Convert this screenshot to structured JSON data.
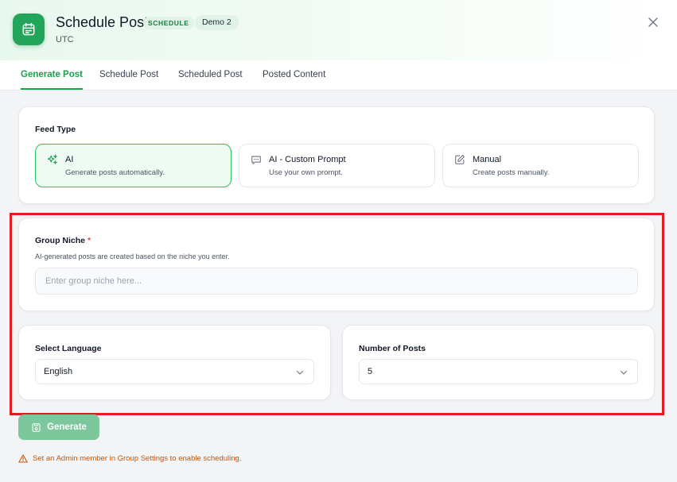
{
  "header": {
    "title": "Schedule Post",
    "badge": "SCHEDULE",
    "group_badge": "Demo 2",
    "timezone": "UTC",
    "app_icon": "calendar-icon",
    "close_icon": "close-icon"
  },
  "tabs": [
    {
      "label": "Generate Post",
      "active": true
    },
    {
      "label": "Schedule Post",
      "active": false
    },
    {
      "label": "Scheduled Post",
      "active": false
    },
    {
      "label": "Posted Content",
      "active": false
    }
  ],
  "feed_type": {
    "label": "Feed Type",
    "options": [
      {
        "title": "AI",
        "desc": "Generate posts automatically.",
        "icon": "sparkles-icon",
        "selected": true
      },
      {
        "title": "AI - Custom Prompt",
        "desc": "Use your own prompt.",
        "icon": "chat-icon",
        "selected": false
      },
      {
        "title": "Manual",
        "desc": "Create posts manually.",
        "icon": "edit-icon",
        "selected": false
      }
    ]
  },
  "group_niche": {
    "label": "Group Niche",
    "required_mark": "*",
    "hint": "AI-generated posts are created based on the niche you enter.",
    "placeholder": "Enter group niche here...",
    "value": ""
  },
  "language": {
    "label": "Select Language",
    "value": "English"
  },
  "posts": {
    "label": "Number of Posts",
    "value": "5"
  },
  "generate_label": "Generate",
  "warning": "Set an Admin member in Group Settings to enable scheduling.",
  "colors": {
    "accent": "#16a34a",
    "highlight": "#e11d24",
    "warning": "#c2570c"
  }
}
